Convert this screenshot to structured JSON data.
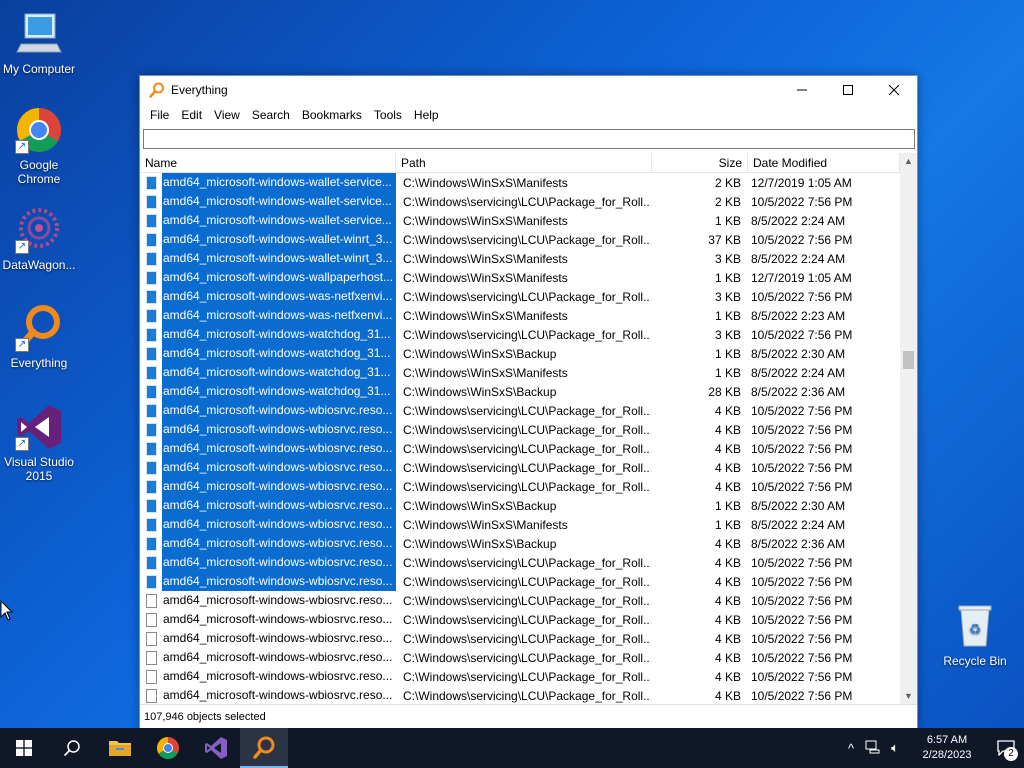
{
  "desktop": {
    "icons": [
      {
        "label": "My Computer"
      },
      {
        "label": "Google Chrome"
      },
      {
        "label": "DataWagon..."
      },
      {
        "label": "Everything"
      },
      {
        "label": "Visual Studio 2015"
      },
      {
        "label": "Recycle Bin"
      }
    ]
  },
  "window": {
    "title": "Everything",
    "menu": [
      "File",
      "Edit",
      "View",
      "Search",
      "Bookmarks",
      "Tools",
      "Help"
    ],
    "search": {
      "value": "",
      "placeholder": ""
    },
    "columns": {
      "name": "Name",
      "path": "Path",
      "size": "Size",
      "date": "Date Modified"
    },
    "rows": [
      {
        "name": "amd64_microsoft-windows-wallet-service...",
        "path": "C:\\Windows\\WinSxS\\Manifests",
        "size": "2 KB",
        "date": "12/7/2019 1:05 AM",
        "selected": true
      },
      {
        "name": "amd64_microsoft-windows-wallet-service...",
        "path": "C:\\Windows\\servicing\\LCU\\Package_for_Roll...",
        "size": "2 KB",
        "date": "10/5/2022 7:56 PM",
        "selected": true
      },
      {
        "name": "amd64_microsoft-windows-wallet-service...",
        "path": "C:\\Windows\\WinSxS\\Manifests",
        "size": "1 KB",
        "date": "8/5/2022 2:24 AM",
        "selected": true
      },
      {
        "name": "amd64_microsoft-windows-wallet-winrt_3...",
        "path": "C:\\Windows\\servicing\\LCU\\Package_for_Roll...",
        "size": "37 KB",
        "date": "10/5/2022 7:56 PM",
        "selected": true
      },
      {
        "name": "amd64_microsoft-windows-wallet-winrt_3...",
        "path": "C:\\Windows\\WinSxS\\Manifests",
        "size": "3 KB",
        "date": "8/5/2022 2:24 AM",
        "selected": true
      },
      {
        "name": "amd64_microsoft-windows-wallpaperhost...",
        "path": "C:\\Windows\\WinSxS\\Manifests",
        "size": "1 KB",
        "date": "12/7/2019 1:05 AM",
        "selected": true
      },
      {
        "name": "amd64_microsoft-windows-was-netfxenvi...",
        "path": "C:\\Windows\\servicing\\LCU\\Package_for_Roll...",
        "size": "3 KB",
        "date": "10/5/2022 7:56 PM",
        "selected": true
      },
      {
        "name": "amd64_microsoft-windows-was-netfxenvi...",
        "path": "C:\\Windows\\WinSxS\\Manifests",
        "size": "1 KB",
        "date": "8/5/2022 2:23 AM",
        "selected": true
      },
      {
        "name": "amd64_microsoft-windows-watchdog_31...",
        "path": "C:\\Windows\\servicing\\LCU\\Package_for_Roll...",
        "size": "3 KB",
        "date": "10/5/2022 7:56 PM",
        "selected": true
      },
      {
        "name": "amd64_microsoft-windows-watchdog_31...",
        "path": "C:\\Windows\\WinSxS\\Backup",
        "size": "1 KB",
        "date": "8/5/2022 2:30 AM",
        "selected": true
      },
      {
        "name": "amd64_microsoft-windows-watchdog_31...",
        "path": "C:\\Windows\\WinSxS\\Manifests",
        "size": "1 KB",
        "date": "8/5/2022 2:24 AM",
        "selected": true
      },
      {
        "name": "amd64_microsoft-windows-watchdog_31...",
        "path": "C:\\Windows\\WinSxS\\Backup",
        "size": "28 KB",
        "date": "8/5/2022 2:36 AM",
        "selected": true
      },
      {
        "name": "amd64_microsoft-windows-wbiosrvc.reso...",
        "path": "C:\\Windows\\servicing\\LCU\\Package_for_Roll...",
        "size": "4 KB",
        "date": "10/5/2022 7:56 PM",
        "selected": true
      },
      {
        "name": "amd64_microsoft-windows-wbiosrvc.reso...",
        "path": "C:\\Windows\\servicing\\LCU\\Package_for_Roll...",
        "size": "4 KB",
        "date": "10/5/2022 7:56 PM",
        "selected": true
      },
      {
        "name": "amd64_microsoft-windows-wbiosrvc.reso...",
        "path": "C:\\Windows\\servicing\\LCU\\Package_for_Roll...",
        "size": "4 KB",
        "date": "10/5/2022 7:56 PM",
        "selected": true
      },
      {
        "name": "amd64_microsoft-windows-wbiosrvc.reso...",
        "path": "C:\\Windows\\servicing\\LCU\\Package_for_Roll...",
        "size": "4 KB",
        "date": "10/5/2022 7:56 PM",
        "selected": true
      },
      {
        "name": "amd64_microsoft-windows-wbiosrvc.reso...",
        "path": "C:\\Windows\\servicing\\LCU\\Package_for_Roll...",
        "size": "4 KB",
        "date": "10/5/2022 7:56 PM",
        "selected": true
      },
      {
        "name": "amd64_microsoft-windows-wbiosrvc.reso...",
        "path": "C:\\Windows\\WinSxS\\Backup",
        "size": "1 KB",
        "date": "8/5/2022 2:30 AM",
        "selected": true
      },
      {
        "name": "amd64_microsoft-windows-wbiosrvc.reso...",
        "path": "C:\\Windows\\WinSxS\\Manifests",
        "size": "1 KB",
        "date": "8/5/2022 2:24 AM",
        "selected": true
      },
      {
        "name": "amd64_microsoft-windows-wbiosrvc.reso...",
        "path": "C:\\Windows\\WinSxS\\Backup",
        "size": "4 KB",
        "date": "8/5/2022 2:36 AM",
        "selected": true
      },
      {
        "name": "amd64_microsoft-windows-wbiosrvc.reso...",
        "path": "C:\\Windows\\servicing\\LCU\\Package_for_Roll...",
        "size": "4 KB",
        "date": "10/5/2022 7:56 PM",
        "selected": true
      },
      {
        "name": "amd64_microsoft-windows-wbiosrvc.reso...",
        "path": "C:\\Windows\\servicing\\LCU\\Package_for_Roll...",
        "size": "4 KB",
        "date": "10/5/2022 7:56 PM",
        "selected": true
      },
      {
        "name": "amd64_microsoft-windows-wbiosrvc.reso...",
        "path": "C:\\Windows\\servicing\\LCU\\Package_for_Roll...",
        "size": "4 KB",
        "date": "10/5/2022 7:56 PM",
        "selected": false
      },
      {
        "name": "amd64_microsoft-windows-wbiosrvc.reso...",
        "path": "C:\\Windows\\servicing\\LCU\\Package_for_Roll...",
        "size": "4 KB",
        "date": "10/5/2022 7:56 PM",
        "selected": false
      },
      {
        "name": "amd64_microsoft-windows-wbiosrvc.reso...",
        "path": "C:\\Windows\\servicing\\LCU\\Package_for_Roll...",
        "size": "4 KB",
        "date": "10/5/2022 7:56 PM",
        "selected": false
      },
      {
        "name": "amd64_microsoft-windows-wbiosrvc.reso...",
        "path": "C:\\Windows\\servicing\\LCU\\Package_for_Roll...",
        "size": "4 KB",
        "date": "10/5/2022 7:56 PM",
        "selected": false
      },
      {
        "name": "amd64_microsoft-windows-wbiosrvc.reso...",
        "path": "C:\\Windows\\servicing\\LCU\\Package_for_Roll...",
        "size": "4 KB",
        "date": "10/5/2022 7:56 PM",
        "selected": false
      },
      {
        "name": "amd64_microsoft-windows-wbiosrvc.reso...",
        "path": "C:\\Windows\\servicing\\LCU\\Package_for_Roll...",
        "size": "4 KB",
        "date": "10/5/2022 7:56 PM",
        "selected": false
      }
    ],
    "status": "107,946 objects selected"
  },
  "taskbar": {
    "clock_time": "6:57 AM",
    "clock_date": "2/28/2023",
    "notification_count": "2",
    "accent": "#76b9ed"
  },
  "colors": {
    "selection": "#0a6ccf",
    "taskbar": "#101827"
  }
}
